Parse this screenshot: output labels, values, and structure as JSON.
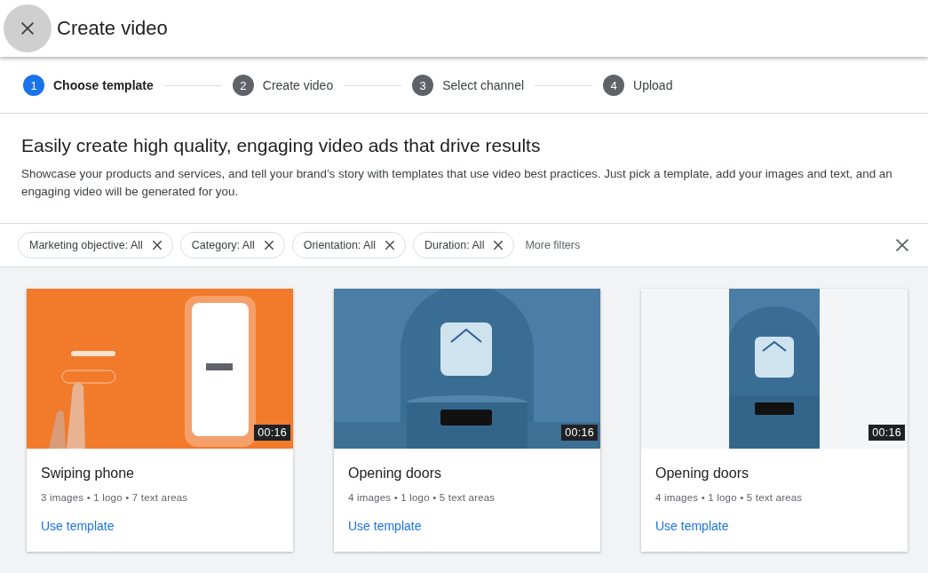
{
  "window": {
    "title": "Create video"
  },
  "steps": [
    {
      "number": "1",
      "label": "Choose template",
      "selected": true
    },
    {
      "number": "2",
      "label": "Create video",
      "selected": false
    },
    {
      "number": "3",
      "label": "Select channel",
      "selected": false
    },
    {
      "number": "4",
      "label": "Upload",
      "selected": false
    }
  ],
  "intro": {
    "heading": "Easily create high quality, engaging video ads that drive results",
    "description": "Showcase your products and services, and tell your brand’s story with templates that use video best practices. Just pick a template, add your images and text, and an engaging video will be generated for you."
  },
  "filters": {
    "chips": [
      {
        "label": "Marketing objective: All"
      },
      {
        "label": "Category: All"
      },
      {
        "label": "Orientation: All"
      },
      {
        "label": "Duration: All"
      }
    ],
    "more": "More filters"
  },
  "templates": [
    {
      "duration": "00:16",
      "title": "Swiping phone",
      "meta": "3 images • 1 logo • 7 text areas",
      "action": "Use template"
    },
    {
      "duration": "00:16",
      "title": "Opening doors",
      "meta": "4 images • 1 logo • 5 text areas",
      "action": "Use template"
    },
    {
      "duration": "00:16",
      "title": "Opening doors",
      "meta": "4 images • 1 logo • 5 text areas",
      "action": "Use template"
    }
  ]
}
